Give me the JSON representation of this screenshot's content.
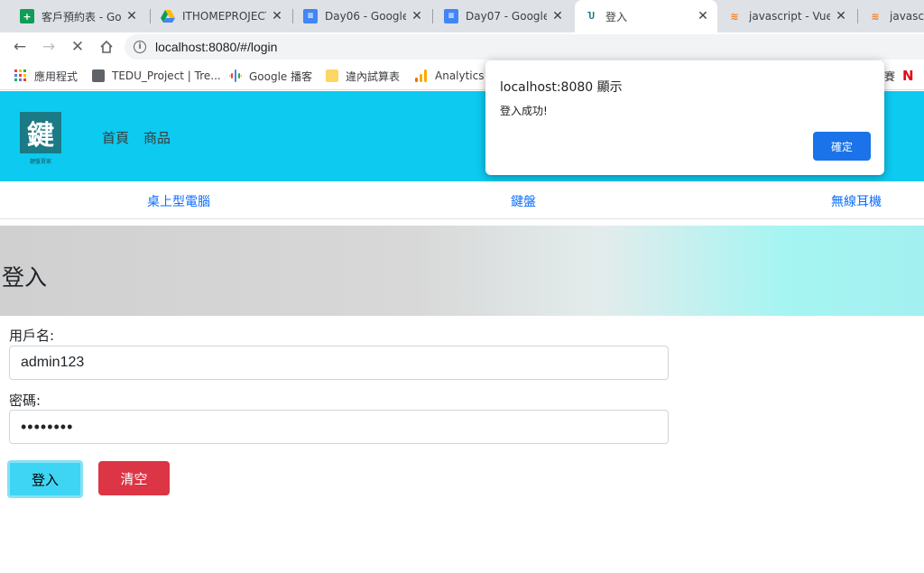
{
  "browser": {
    "tabs": [
      {
        "title": "客戶預約表 - Goo",
        "icon": "google-sheets-icon",
        "color": "#0f9d58"
      },
      {
        "title": "ITHOMEPROJECT",
        "icon": "google-drive-icon",
        "color": "#4285f4"
      },
      {
        "title": "Day06 - Google",
        "icon": "google-docs-icon",
        "color": "#4285f4"
      },
      {
        "title": "Day07 - Google",
        "icon": "google-docs-icon",
        "color": "#4285f4"
      },
      {
        "title": "登入",
        "icon": "vue-app-icon",
        "color": "#41b883"
      },
      {
        "title": "javascript - Vue",
        "icon": "stackoverflow-icon",
        "color": "#f48024"
      },
      {
        "title": "javascri",
        "icon": "stackoverflow-icon",
        "color": "#f48024"
      }
    ],
    "url": "localhost:8080/#/login",
    "bookmarks": [
      {
        "label": "應用程式",
        "icon": "apps-grid-icon"
      },
      {
        "label": "TEDU_Project | Tre...",
        "icon": "trello-icon"
      },
      {
        "label": "Google 播客",
        "icon": "google-podcasts-icon"
      },
      {
        "label": "違內試算表",
        "icon": "folder-icon"
      },
      {
        "label": "Analytics",
        "icon": "analytics-icon"
      },
      {
        "label": "賽",
        "icon": "bookmark-icon"
      }
    ]
  },
  "site": {
    "logo_char": "鍵",
    "logo_sub": "鍵盤賣家",
    "nav": [
      "首頁",
      "商品"
    ],
    "categories": [
      "桌上型電腦",
      "鍵盤",
      "無線耳機"
    ]
  },
  "page": {
    "title": "登入",
    "username_label": "用戶名:",
    "username_value": "admin123",
    "password_label": "密碼:",
    "password_mask": "••••••••",
    "login_button": "登入",
    "clear_button": "清空"
  },
  "dialog": {
    "title": "localhost:8080 顯示",
    "message": "登入成功!",
    "ok_button": "確定"
  },
  "colors": {
    "header": "#0dcaf0",
    "primary_link": "#0d6efd",
    "login_button": "#3dd5f3",
    "clear_button": "#dc3545",
    "dialog_ok": "#1a73e8"
  }
}
